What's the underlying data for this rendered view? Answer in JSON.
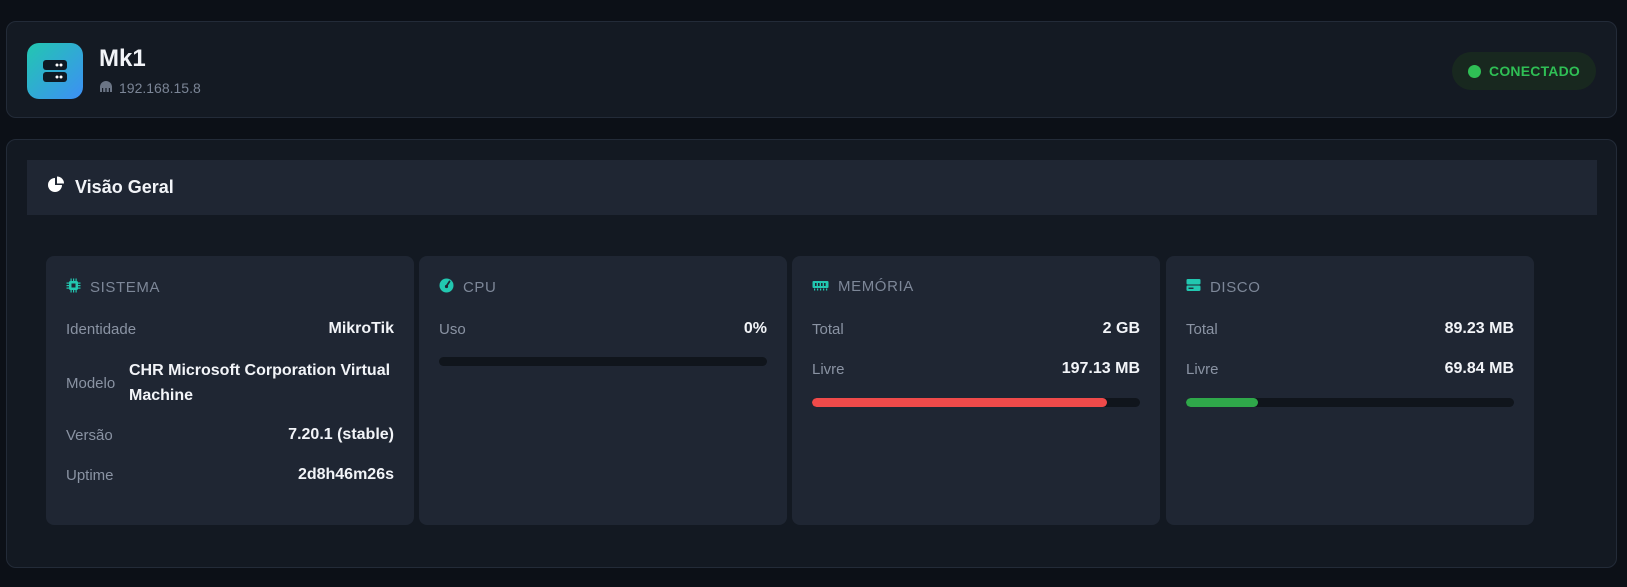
{
  "device": {
    "name": "Mk1",
    "ip": "192.168.15.8",
    "status": "CONECTADO",
    "status_color": "#2fbf55"
  },
  "section": {
    "title": "Visão Geral"
  },
  "sistema": {
    "title": "SISTEMA",
    "rows": [
      {
        "label": "Identidade",
        "value": "MikroTik"
      },
      {
        "label": "Modelo",
        "value": "CHR Microsoft Corporation Virtual Machine"
      },
      {
        "label": "Versão",
        "value": "7.20.1 (stable)"
      },
      {
        "label": "Uptime",
        "value": "2d8h46m26s"
      }
    ]
  },
  "cpu": {
    "title": "CPU",
    "uso_label": "Uso",
    "uso_value": "0%",
    "usage_fraction": 0.0
  },
  "memoria": {
    "title": "MEMÓRIA",
    "total_label": "Total",
    "total_value": "2 GB",
    "livre_label": "Livre",
    "livre_value": "197.13 MB",
    "usage_fraction": 0.9,
    "bar_color": "#ef4a4a"
  },
  "disco": {
    "title": "DISCO",
    "total_label": "Total",
    "total_value": "89.23 MB",
    "livre_label": "Livre",
    "livre_value": "69.84 MB",
    "usage_fraction": 0.22,
    "bar_color": "#2fa84a"
  },
  "colors": {
    "accent": "#22c7b0",
    "background": "#0c1017",
    "panel": "#1f2633"
  },
  "icons": {
    "logo": "server-icon",
    "ip": "network-icon",
    "section": "pie-chart-icon",
    "sistema": "chip-icon",
    "cpu": "gauge-icon",
    "memoria": "memory-icon",
    "disco": "drive-icon"
  }
}
